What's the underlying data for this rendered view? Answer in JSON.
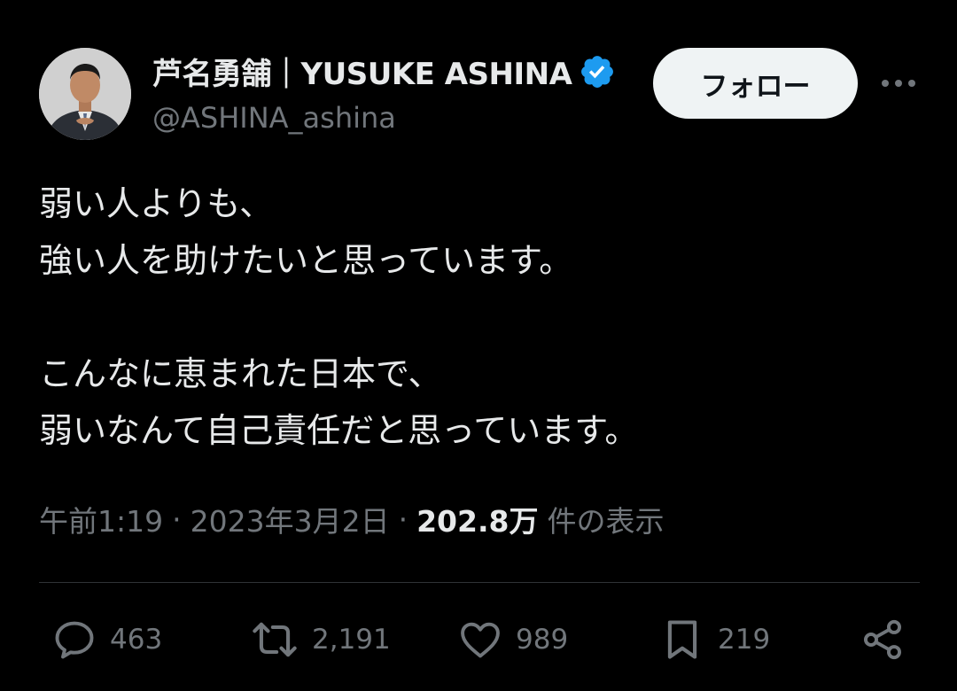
{
  "user": {
    "display_name": "芦名勇舗｜YUSUKE ASHINA",
    "handle": "@ASHINA_ashina",
    "verified_color": "#1d9bf0"
  },
  "follow_label": "フォロー",
  "more_icon": "more-horizontal-icon",
  "tweet": {
    "text": "弱い人よりも、\n強い人を助けたいと思っています。\n\nこんなに恵まれた日本で、\n弱いなんて自己責任だと思っています。"
  },
  "meta": {
    "time": "午前1:19",
    "separator": "·",
    "date": "2023年3月2日",
    "views_count": "202.8万",
    "views_label": "件の表示"
  },
  "actions": {
    "reply_count": "463",
    "retweet_count": "2,191",
    "like_count": "989",
    "bookmark_count": "219"
  },
  "colors": {
    "background": "#000000",
    "text": "#e7e9ea",
    "secondary": "#71767b",
    "divider": "#2f3336",
    "button_bg": "#eff3f4"
  }
}
